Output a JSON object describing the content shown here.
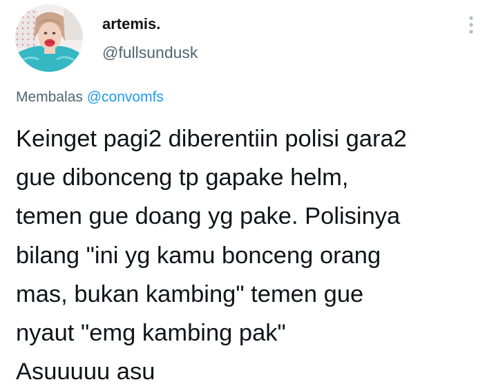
{
  "tweet": {
    "author": {
      "display_name": "artemis.",
      "handle": "@fullsundusk",
      "avatar_icon": "profile-photo"
    },
    "more_icon": "vertical-ellipsis-icon",
    "reply_context": {
      "prefix": "Membalas",
      "mention": "@convomfs"
    },
    "text_lines": [
      "Keinget pagi2 diberentiin polisi gara2",
      "gue dibonceng tp gapake helm,",
      "temen gue doang yg pake. Polisinya",
      "bilang \"ini yg kamu bonceng orang",
      "mas, bukan kambing\" temen gue",
      "nyaut \"emg kambing pak\"",
      "Asuuuuu asu"
    ]
  },
  "colors": {
    "background": "#ffffff",
    "text_primary": "#0f1419",
    "text_secondary": "#536471",
    "accent_link": "#1d9bf0",
    "icon_gray": "#b5bcc3"
  }
}
